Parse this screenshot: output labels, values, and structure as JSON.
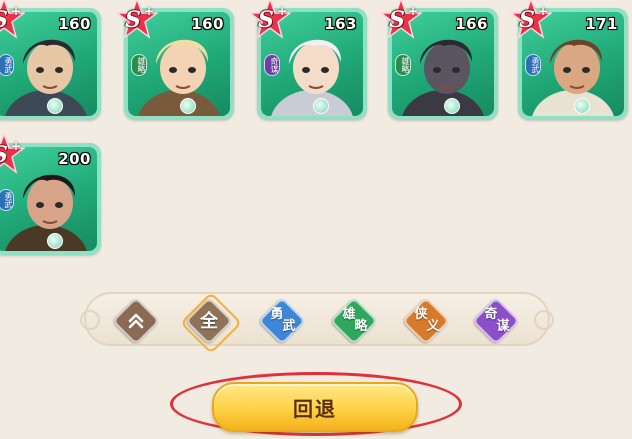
{
  "heroes": [
    {
      "rank": "S",
      "rank_plus": "+",
      "level": "160",
      "class_tag": "勇武",
      "tag_color": "blue",
      "skin": "#e8c7a6",
      "hair": "#2a2a33",
      "outfit": "#3d4a55"
    },
    {
      "rank": "S",
      "rank_plus": "+",
      "level": "160",
      "class_tag": "雄略",
      "tag_color": "green",
      "skin": "#f4d2b4",
      "hair": "#f1dca4",
      "outfit": "#7a5a3a"
    },
    {
      "rank": "S",
      "rank_plus": "+",
      "level": "163",
      "class_tag": "奇谋",
      "tag_color": "purple",
      "skin": "#f5dcc9",
      "hair": "#f0f0f4",
      "outfit": "#c9ccd6"
    },
    {
      "rank": "S",
      "rank_plus": "+",
      "level": "166",
      "class_tag": "雄略",
      "tag_color": "green",
      "skin": "#5a5560",
      "hair": "#2c2a30",
      "outfit": "#3b3a42"
    },
    {
      "rank": "S",
      "rank_plus": "+",
      "level": "171",
      "class_tag": "勇武",
      "tag_color": "blue",
      "skin": "#d9a781",
      "hair": "#6b4326",
      "outfit": "#e8e2d2"
    },
    {
      "rank": "S",
      "rank_plus": "+",
      "level": "200",
      "class_tag": "勇武",
      "tag_color": "blue",
      "skin": "#d7a48a",
      "hair": "#1e1a1c",
      "outfit": "#4a3a25"
    }
  ],
  "filters": [
    {
      "label": "",
      "icon": "collapse-chevrons-icon",
      "color": "#8a6a52",
      "selected": false
    },
    {
      "label": "全",
      "icon": "",
      "color": "#8f7358",
      "selected": true
    },
    {
      "label1": "勇",
      "label2": "武",
      "color": "#3f86d6",
      "selected": false
    },
    {
      "label1": "雄",
      "label2": "略",
      "color": "#2fa75c",
      "selected": false
    },
    {
      "label1": "侠",
      "label2": "义",
      "color": "#d87a2c",
      "selected": false
    },
    {
      "label1": "奇",
      "label2": "谋",
      "color": "#8a4fc9",
      "selected": false
    }
  ],
  "back_button": {
    "label": "回退"
  },
  "colors": {
    "card_border": "#8fe0c4",
    "card_bg": "#20a877",
    "accent_ring": "#e2303b",
    "background": "#f1ebe2"
  }
}
